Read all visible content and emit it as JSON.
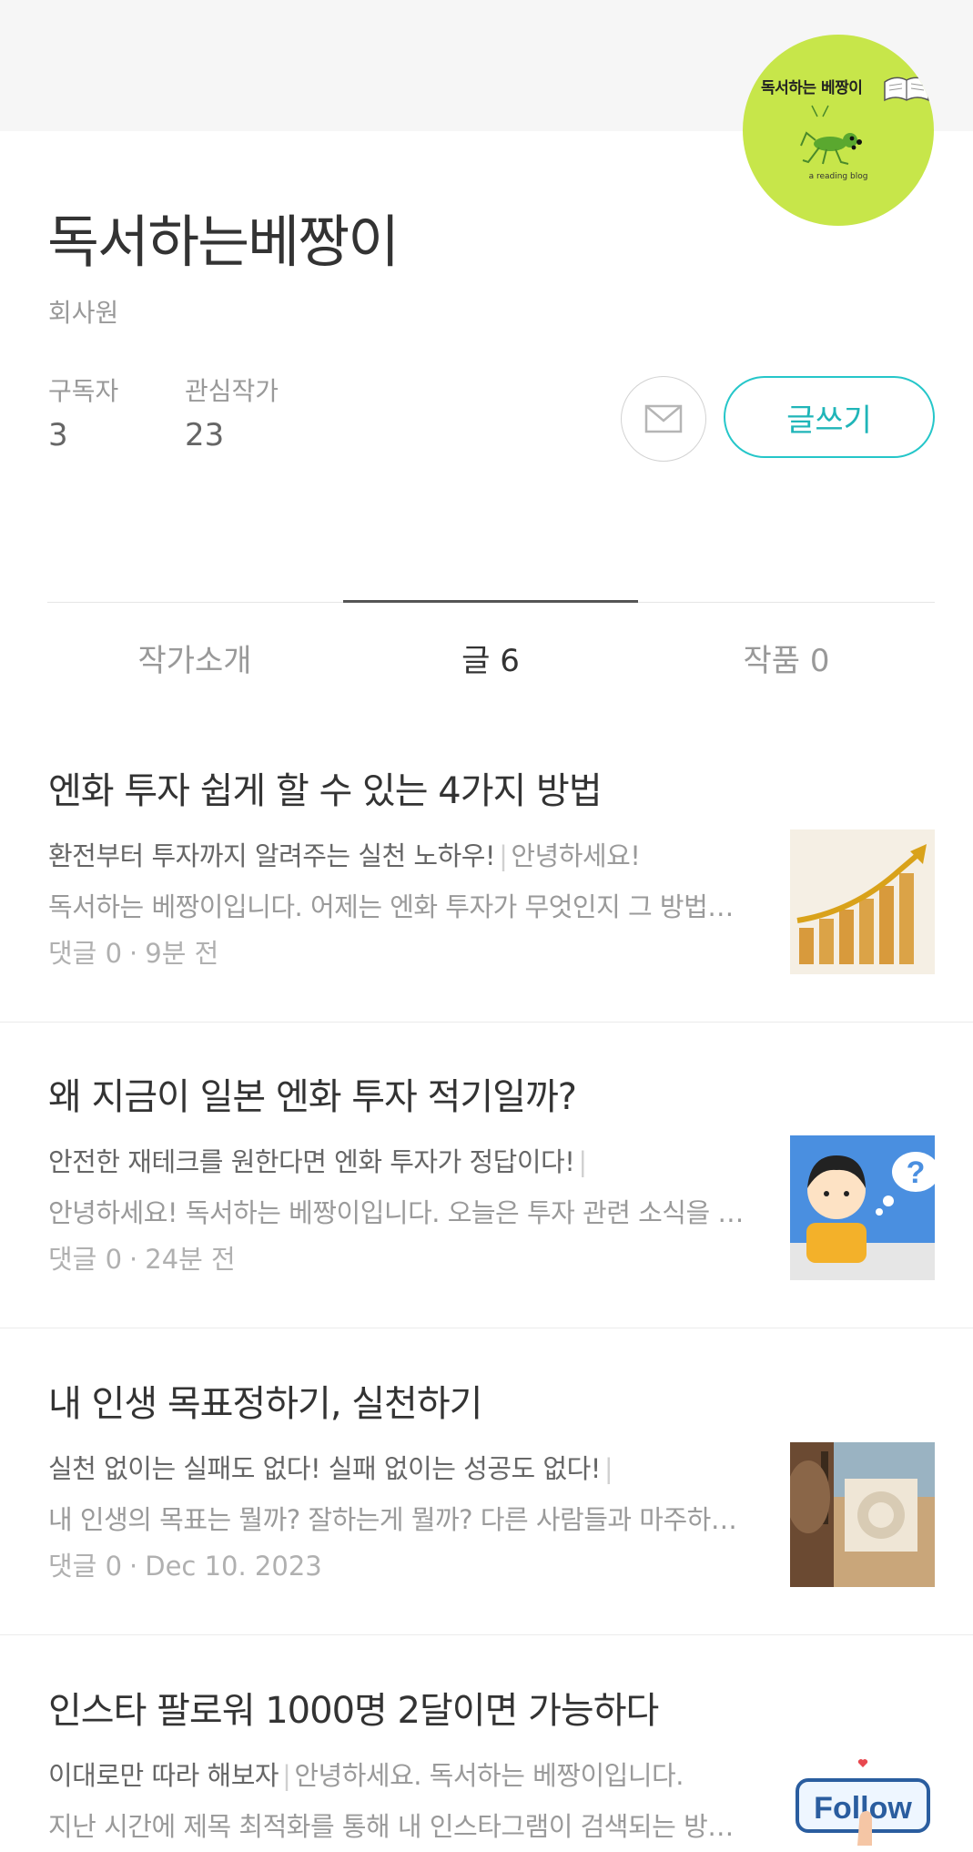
{
  "profile": {
    "avatar_title": "독서하는 베짱이",
    "avatar_subtitle": "a reading blog",
    "name": "독서하는베짱이",
    "job": "회사원",
    "stats": [
      {
        "label": "구독자",
        "value": "3"
      },
      {
        "label": "관심작가",
        "value": "23"
      }
    ],
    "write_button": "글쓰기"
  },
  "tabs": [
    {
      "label": "작가소개"
    },
    {
      "label": "글 6"
    },
    {
      "label": "작품 0"
    }
  ],
  "posts": [
    {
      "title": "엔화 투자 쉽게 할 수 있는 4가지 방법",
      "subtitle": "환전부터 투자까지 알려주는 실천 노하우!",
      "line1_rest": "안녕하세요!",
      "line2": "독서하는 베짱이입니다.  어제는 엔화 투자가 무엇인지 그 방법에 대해 알아보았습니다.",
      "comments": "댓글 0",
      "time": "9분 전",
      "thumb_icon": "bar-chart-growth-thumbnail"
    },
    {
      "title": "왜 지금이 일본 엔화 투자 적기일까?",
      "subtitle": "안전한 재테크를 원한다면 엔화 투자가 정답이다!",
      "line1_rest": "",
      "line2": "안녕하세요! 독서하는 베짱이입니다.  오늘은 투자 관련 소식을 전해드리려고 합니다.",
      "comments": "댓글 0",
      "time": "24분 전",
      "thumb_icon": "thinking-person-thumbnail"
    },
    {
      "title": "내 인생 목표정하기, 실천하기",
      "subtitle": "실천 없이는 실패도 없다! 실패 없이는 성공도 없다!",
      "line1_rest": "",
      "line2": "내 인생의 목표는 뭘까? 잘하는게 뭘까?  다른 사람들과 마주하며 생각해 봅니다.",
      "comments": "댓글 0",
      "time": "Dec 10. 2023",
      "thumb_icon": "archery-target-thumbnail"
    },
    {
      "title": "인스타 팔로워 1000명 2달이면 가능하다",
      "subtitle": "이대로만 따라 해보자",
      "line1_rest": "안녕하세요. 독서하는 베짱이입니다.",
      "line2": "지난 시간에 제목 최적화를 통해 내 인스타그램이 검색되는 방법을 알아보았습니다.",
      "comments": "",
      "time": "",
      "thumb_icon": "follow-button-thumbnail",
      "thumb_text": "Follow"
    }
  ]
}
